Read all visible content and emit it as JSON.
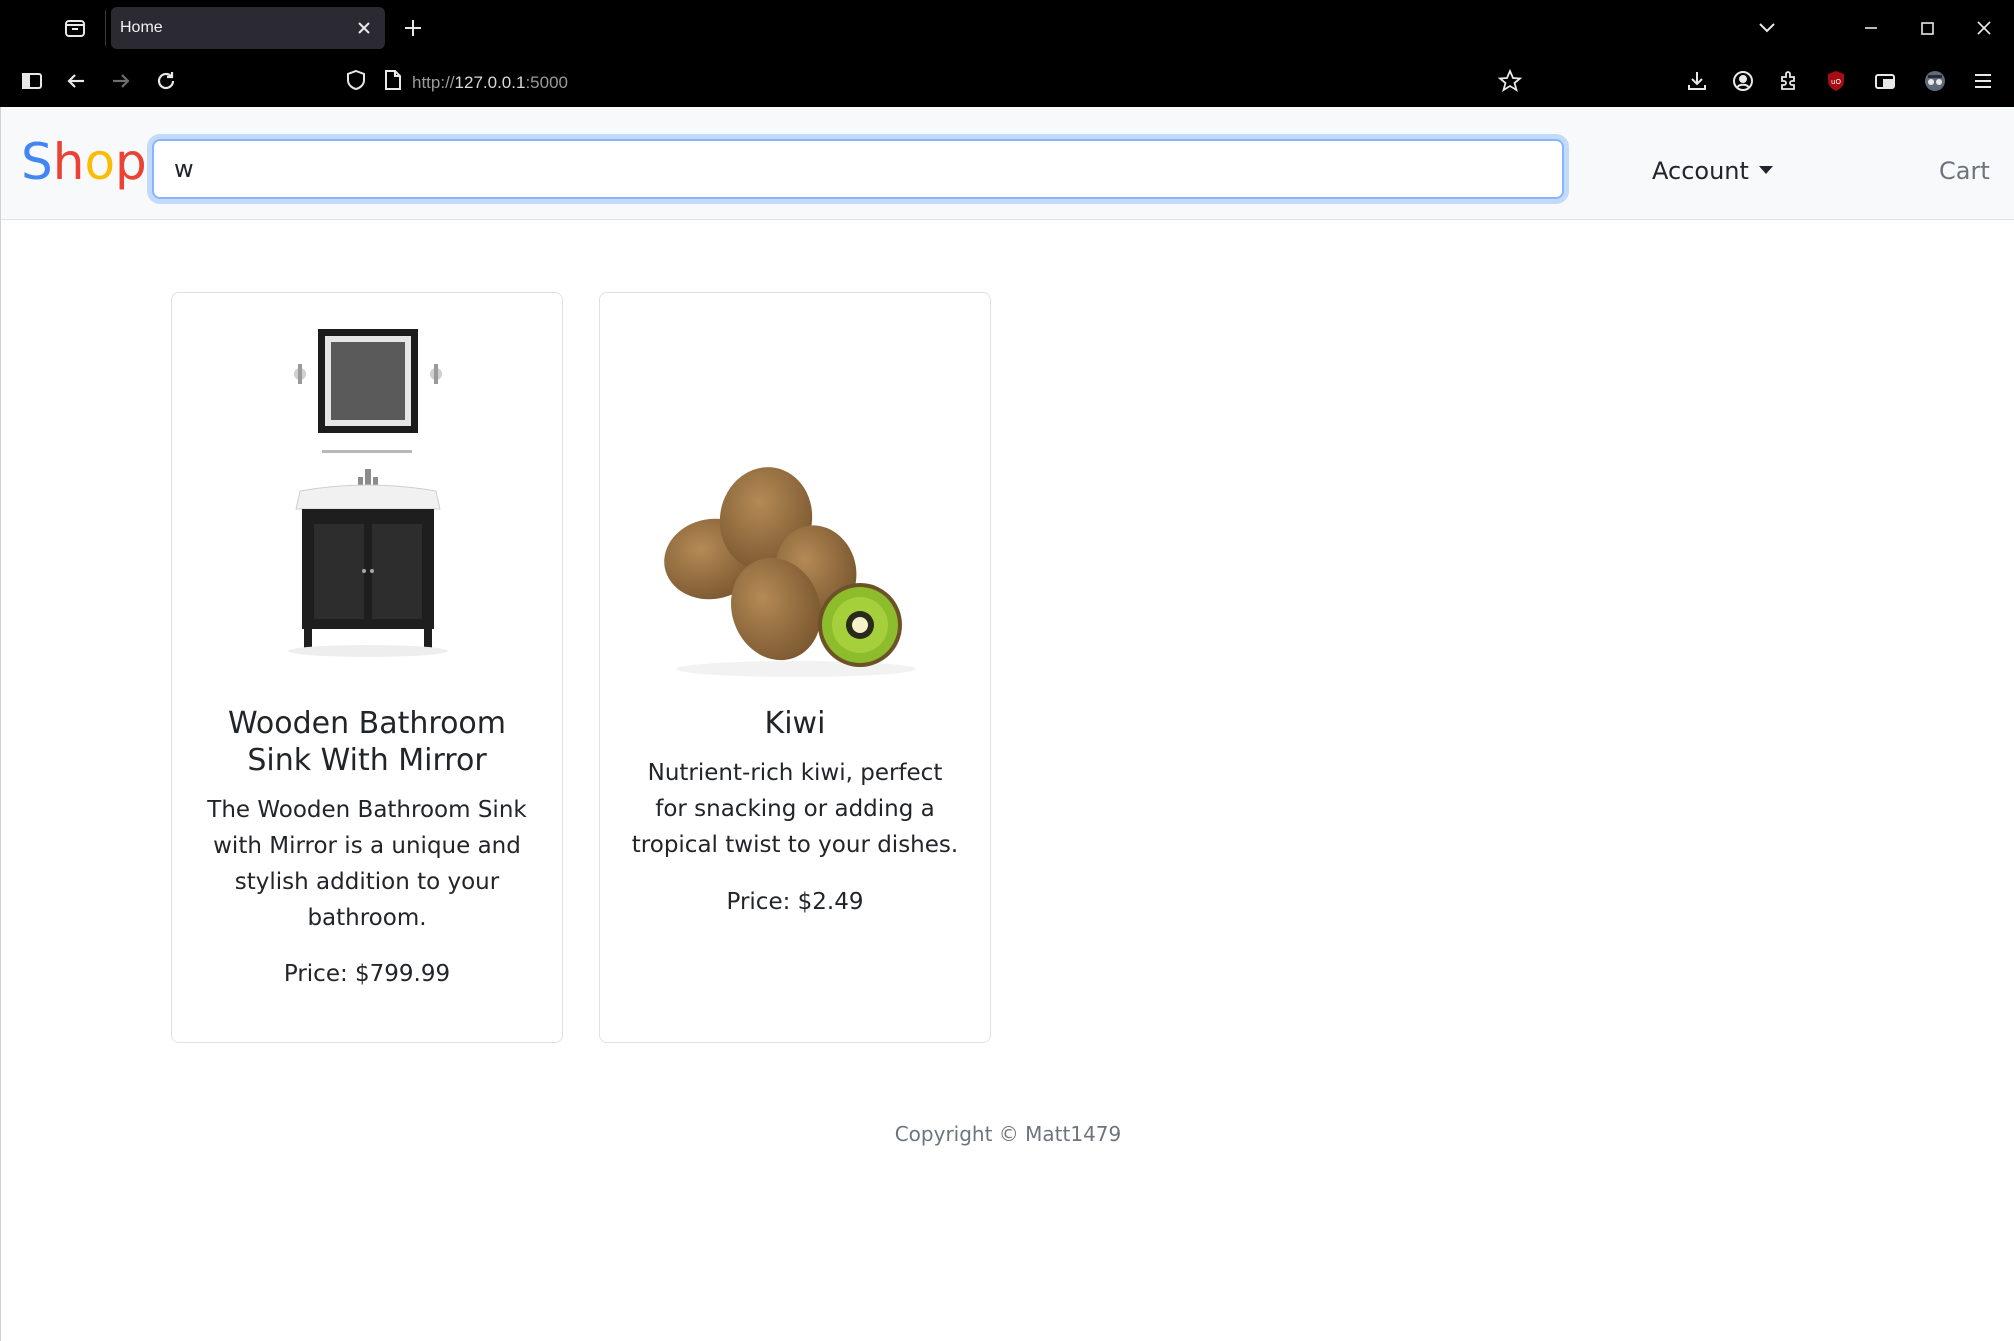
{
  "browser": {
    "tab_title": "Home",
    "url_prefix": "http://",
    "url_host": "127.0.0.1",
    "url_port": ":5000"
  },
  "site": {
    "brand_letters": [
      {
        "ch": "S",
        "color": "#4285f4"
      },
      {
        "ch": "h",
        "color": "#ea4335"
      },
      {
        "ch": "o",
        "color": "#fbbc05"
      },
      {
        "ch": "p",
        "color": "#ea4335"
      }
    ],
    "search_value": "w",
    "account_label": "Account",
    "cart_label": "Cart"
  },
  "products": [
    {
      "title": "Wooden Bathroom Sink With Mirror",
      "description": "The Wooden Bathroom Sink with Mirror is a unique and stylish addition to your bathroom.",
      "price": "Price: $799.99",
      "image": "bathroom-sink-image"
    },
    {
      "title": "Kiwi",
      "description": "Nutrient-rich kiwi, perfect for snacking or adding a tropical twist to your dishes.",
      "price": "Price: $2.49",
      "image": "kiwi-image"
    }
  ],
  "footer": {
    "copyright": "Copyright © Matt1479"
  }
}
